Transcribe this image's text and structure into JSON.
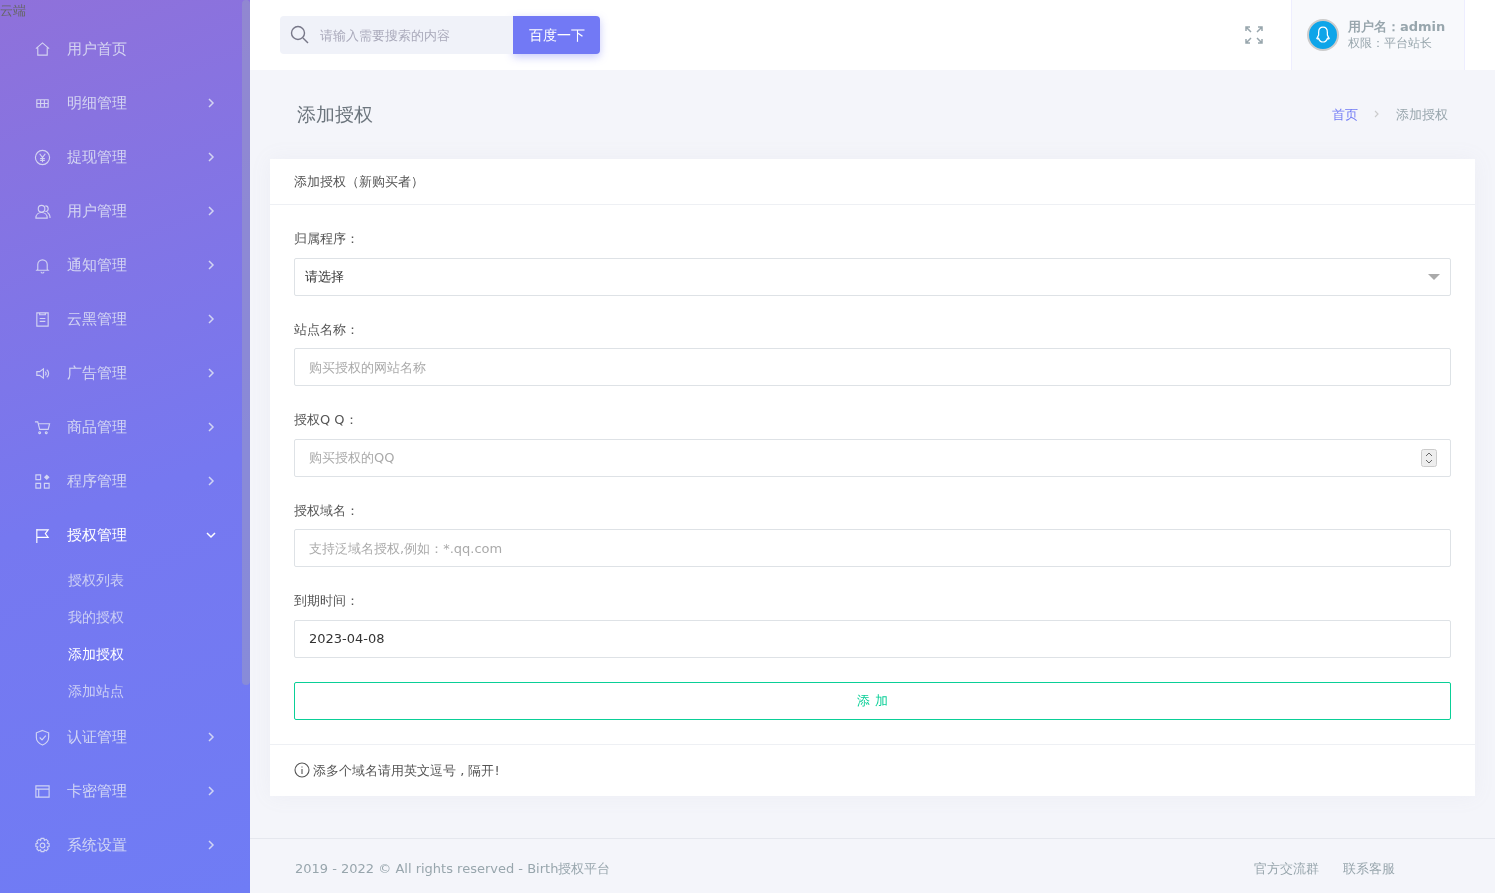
{
  "logo_alt": "云端",
  "sidebar": {
    "items": [
      {
        "kind": "link",
        "label": "用户首页",
        "expanded": false
      },
      {
        "kind": "menu",
        "label": "明细管理",
        "expanded": false
      },
      {
        "kind": "menu",
        "label": "提现管理",
        "expanded": false
      },
      {
        "kind": "menu",
        "label": "用户管理",
        "expanded": false
      },
      {
        "kind": "menu",
        "label": "通知管理",
        "expanded": false
      },
      {
        "kind": "menu",
        "label": "云黑管理",
        "expanded": false
      },
      {
        "kind": "menu",
        "label": "广告管理",
        "expanded": false
      },
      {
        "kind": "menu",
        "label": "商品管理",
        "expanded": false
      },
      {
        "kind": "menu",
        "label": "程序管理",
        "expanded": false
      },
      {
        "kind": "menu",
        "label": "授权管理",
        "expanded": true,
        "children": [
          {
            "label": "授权列表",
            "selected": false
          },
          {
            "label": "我的授权",
            "selected": false
          },
          {
            "label": "添加授权",
            "selected": true
          },
          {
            "label": "添加站点",
            "selected": false
          }
        ]
      },
      {
        "kind": "menu",
        "label": "认证管理",
        "expanded": false
      },
      {
        "kind": "menu",
        "label": "卡密管理",
        "expanded": false
      },
      {
        "kind": "menu",
        "label": "系统设置",
        "expanded": false
      }
    ]
  },
  "topbar": {
    "search": {
      "placeholder": "请输入需要搜索的内容"
    },
    "search_button": "百度一下",
    "user": {
      "name_label": "用户名：admin",
      "role_label": "权限：平台站长"
    }
  },
  "page_title": "添加授权",
  "breadcrumb": [
    {
      "label": "首页",
      "selected": false
    },
    {
      "label": "添加授权",
      "selected": true
    }
  ],
  "form": {
    "title": "添加授权（新购买者）",
    "fields": [
      {
        "kind": "select",
        "label": "归属程序：",
        "value": "请选择"
      },
      {
        "kind": "text",
        "label": "站点名称：",
        "placeholder": "购买授权的网站名称"
      },
      {
        "kind": "number",
        "label": "授权Q Q：",
        "placeholder": "购买授权的QQ"
      },
      {
        "kind": "text",
        "label": "授权域名：",
        "placeholder": "支持泛域名授权,例如：*.qq.com"
      },
      {
        "kind": "text",
        "label": "到期时间：",
        "value": "2023-04-08"
      }
    ],
    "submit": "添 加",
    "note": "添多个域名请用英文逗号 , 隔开!"
  },
  "footer": {
    "copyright": "2019 - 2022 © All rights reserved - Birth授权平台",
    "links": [
      "官方交流群",
      "联系客服"
    ]
  }
}
